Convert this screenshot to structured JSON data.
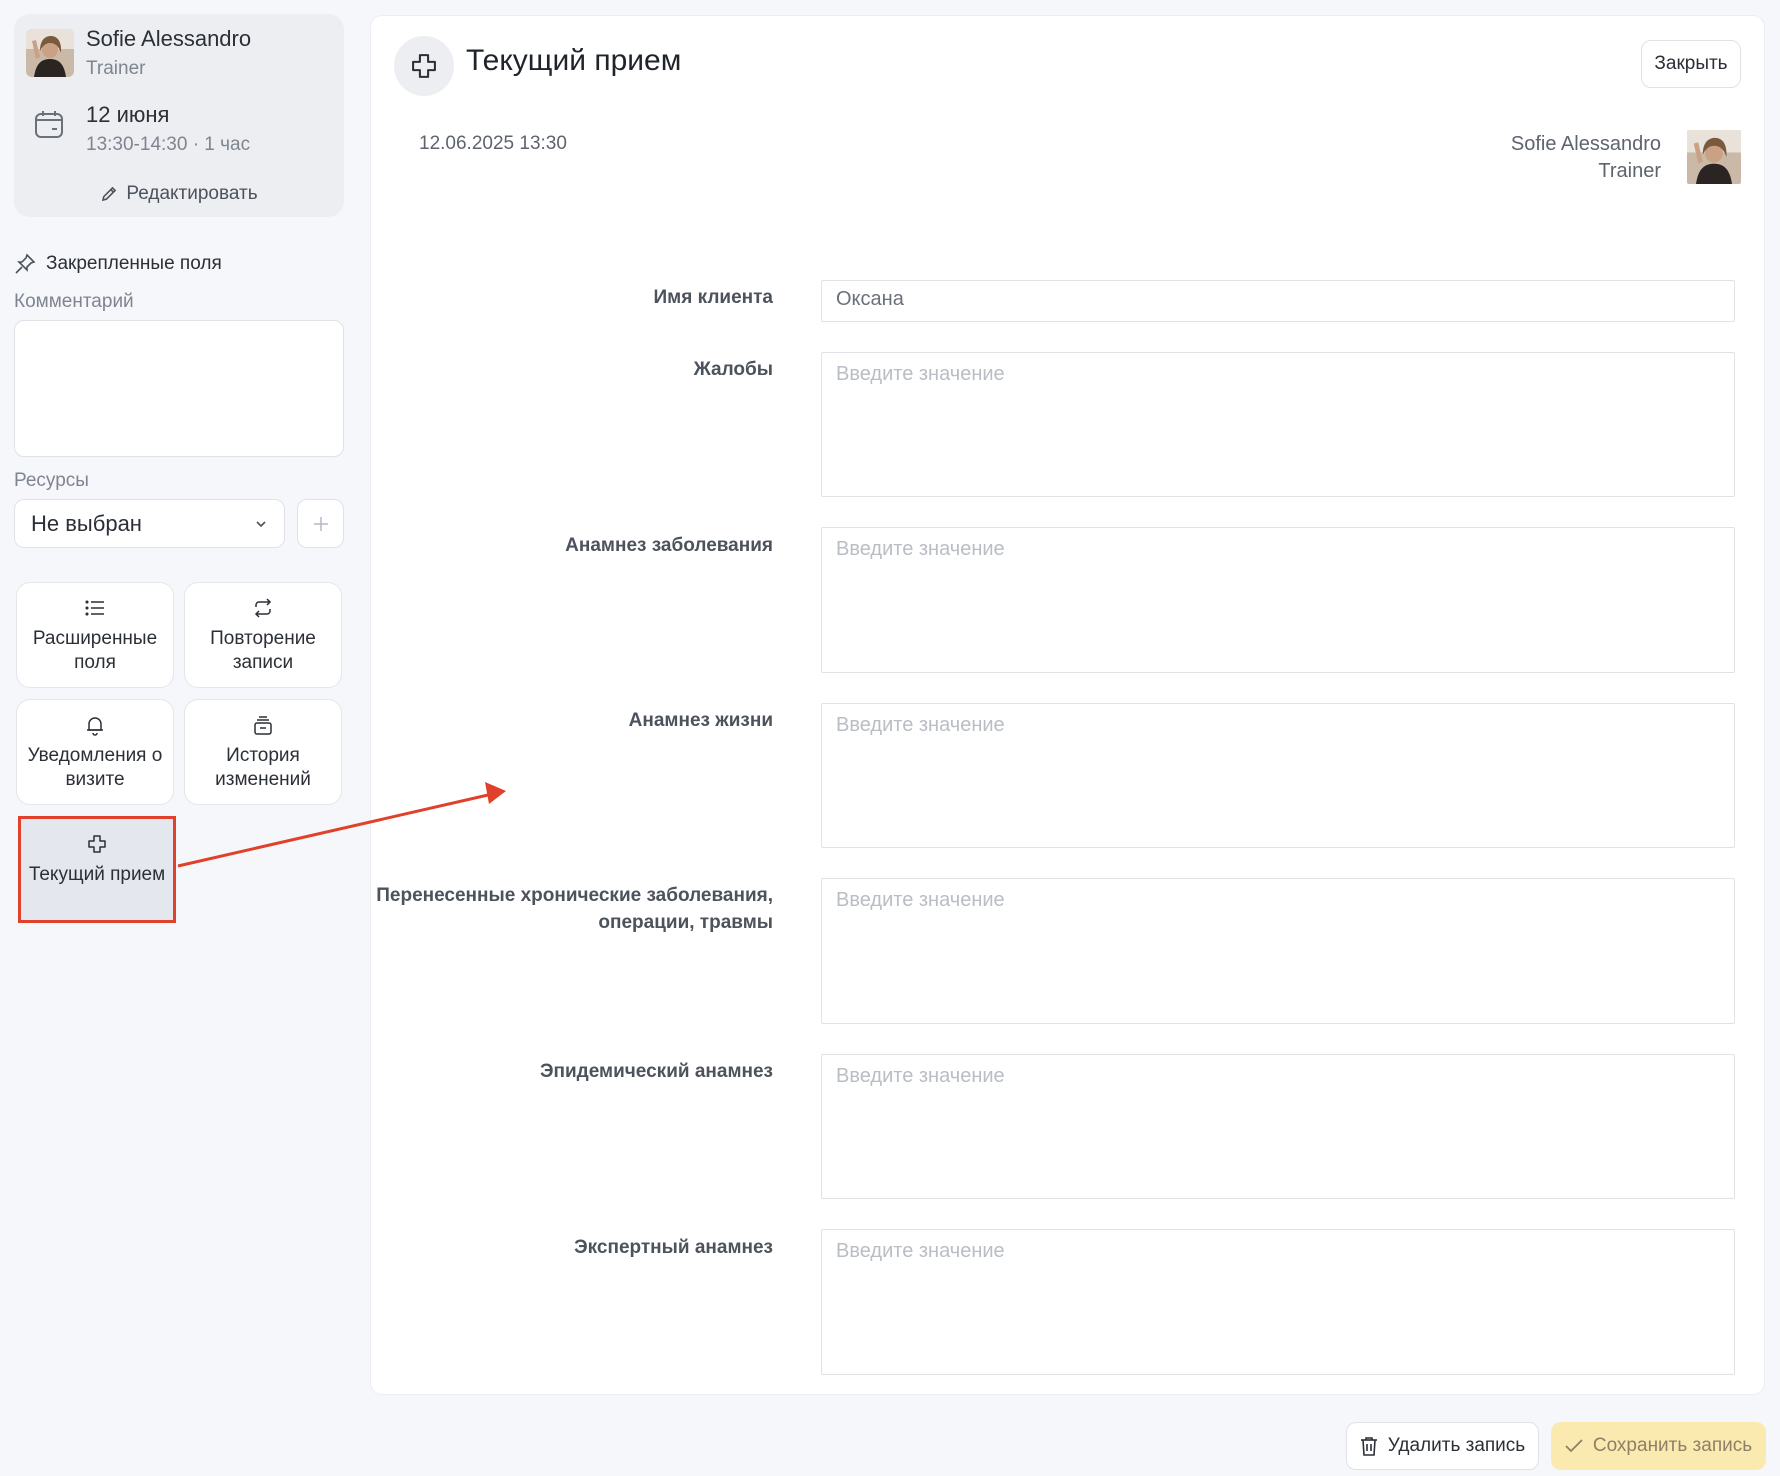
{
  "appointment": {
    "staff_name": "Sofie Alessandro",
    "staff_role": "Trainer",
    "date": "12 июня",
    "time": "13:30-14:30 · 1 час",
    "edit_label": "Редактировать"
  },
  "sidebar": {
    "pinned_title": "Закрепленные поля",
    "comment_label": "Комментарий",
    "comment_value": "",
    "resources_label": "Ресурсы",
    "resources_value": "Не выбран",
    "tiles": [
      {
        "label": "Расширенные поля",
        "icon": "list-icon"
      },
      {
        "label": "Повторение записи",
        "icon": "repeat-icon"
      },
      {
        "label": "Уведомления о визите",
        "icon": "bell-icon"
      },
      {
        "label": "История изменений",
        "icon": "history-icon"
      },
      {
        "label": "Текущий прием",
        "icon": "medical-cross-icon"
      }
    ]
  },
  "main": {
    "title": "Текущий прием",
    "close_label": "Закрыть",
    "datetime": "12.06.2025 13:30",
    "doctor_name": "Sofie Alessandro",
    "doctor_role": "Trainer",
    "placeholder": "Введите значение",
    "fields": [
      {
        "label": "Имя клиента",
        "value": "Оксана"
      },
      {
        "label": "Жалобы",
        "value": ""
      },
      {
        "label": "Анамнез заболевания",
        "value": ""
      },
      {
        "label": "Анамнез жизни",
        "value": ""
      },
      {
        "label": "Перенесенные хронические заболевания, операции, травмы",
        "value": ""
      },
      {
        "label": "Эпидемический анамнез",
        "value": ""
      },
      {
        "label": "Экспертный анамнез",
        "value": ""
      }
    ]
  },
  "footer": {
    "delete_label": "Удалить запись",
    "save_label": "Сохранить запись"
  },
  "colors": {
    "annotation": "#e0412b",
    "save_button": "#fbeab0",
    "panel": "#ffffff",
    "background": "#f6f7fa"
  }
}
